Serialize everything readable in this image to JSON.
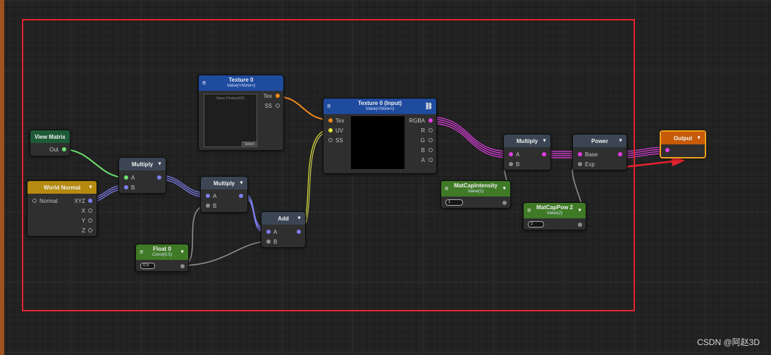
{
  "nodes": {
    "view_matrix": {
      "title": "View Matrix",
      "out": "Out"
    },
    "world_normal": {
      "title": "World Normal",
      "in": "Normal",
      "outs": [
        "XYZ",
        "X",
        "Y",
        "Z"
      ]
    },
    "multiply1": {
      "title": "Multiply",
      "a": "A",
      "b": "B"
    },
    "multiply2": {
      "title": "Multiply",
      "a": "A",
      "b": "B"
    },
    "add": {
      "title": "Add",
      "a": "A",
      "b": "B"
    },
    "float0": {
      "title": "Float 0",
      "sub": "Const(0.5)",
      "value": "0.5"
    },
    "texture0": {
      "title": "Texture 0",
      "sub": "Value(<None>)",
      "preview": "None (Texture2D)",
      "select": "Select",
      "tex": "Tex",
      "ss": "SS"
    },
    "texture_input": {
      "title": "Texture 0 (Input)",
      "sub": "Value(<None>)",
      "ins": [
        "Tex",
        "UV",
        "SS"
      ],
      "outs": [
        "RGBA",
        "R",
        "G",
        "B",
        "A"
      ]
    },
    "matcap_intensity": {
      "title": "MatCapIntensity",
      "sub": "Value(1)",
      "value": "1"
    },
    "multiply3": {
      "title": "Multiply",
      "a": "A",
      "b": "B"
    },
    "matcap_pow": {
      "title": "MatCapPow 2",
      "sub": "Value(2)",
      "value": "2"
    },
    "power": {
      "title": "Power",
      "base": "Base",
      "exp": "Exp"
    },
    "output": {
      "title": "Output"
    }
  },
  "colors": {
    "frame": "#e8232f",
    "arrow": "#e8232f",
    "vector": "#7f7ff0",
    "color": "#e43ee4",
    "texture": "#f18a1f",
    "uv": "#e6e639",
    "float": "#8c8c8c"
  },
  "watermark": "CSDN @阿赵3D"
}
